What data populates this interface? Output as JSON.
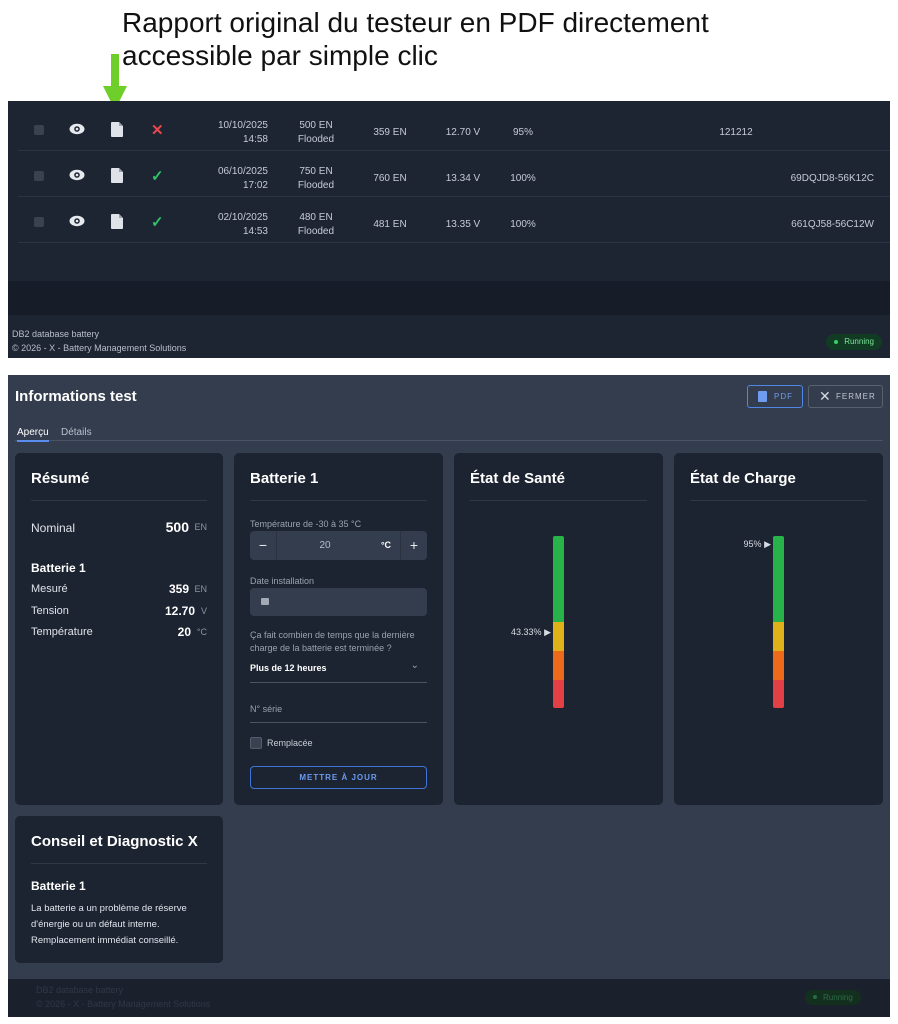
{
  "annotation": {
    "text": "Rapport original du testeur en PDF directement accessible par simple clic"
  },
  "top_table": {
    "rows": [
      {
        "date": "10/10/2025",
        "time": "14:58",
        "nominal": "500 EN",
        "type": "Flooded",
        "measured": "359 EN",
        "voltage": "12.70 V",
        "soh": "95%",
        "code": "121212",
        "serial": "",
        "status": "fail",
        "status_glyph": "✕"
      },
      {
        "date": "06/10/2025",
        "time": "17:02",
        "nominal": "750 EN",
        "type": "Flooded",
        "measured": "760 EN",
        "voltage": "13.34 V",
        "soh": "100%",
        "code": "",
        "serial": "69DQJD8-56K12C",
        "status": "ok",
        "status_glyph": "✓"
      },
      {
        "date": "02/10/2025",
        "time": "14:53",
        "nominal": "480 EN",
        "type": "Flooded",
        "measured": "481 EN",
        "voltage": "13.35 V",
        "soh": "100%",
        "code": "",
        "serial": "661QJ58-56C12W",
        "status": "ok",
        "status_glyph": "✓"
      }
    ]
  },
  "footer": {
    "app": "DB2 database battery",
    "copyright": "© 2026 - X - Battery Management Solutions",
    "status": "Running"
  },
  "dialog": {
    "title": "Informations test",
    "pdf_button": "PDF",
    "close_button": "FERMER",
    "tabs": [
      "Aperçu",
      "Détails"
    ]
  },
  "resume": {
    "title": "Résumé",
    "nominal_label": "Nominal",
    "nominal_value": "500",
    "nominal_unit": "EN",
    "battery_label": "Batterie 1",
    "rows": [
      {
        "label": "Mesuré",
        "value": "359",
        "unit": "EN"
      },
      {
        "label": "Tension",
        "value": "12.70",
        "unit": "V"
      },
      {
        "label": "Température",
        "value": "20",
        "unit": "°C"
      }
    ]
  },
  "battery_form": {
    "title": "Batterie 1",
    "temp_label": "Température de -30 à 35 °C",
    "temp_value": "20",
    "temp_unit": "°C",
    "minus": "−",
    "plus": "+",
    "date_label": "Date installation",
    "question": "Ça fait combien de temps que la dernière charge de la batterie est terminée ?",
    "charge_select": "Plus de 12 heures",
    "serial_label": "N° série",
    "replaced_label": "Remplacée",
    "update_button": "METTRE À JOUR"
  },
  "soh": {
    "title": "État de Santé",
    "marker": "43.33%",
    "value": 0.4333
  },
  "soc": {
    "title": "État de Charge",
    "marker": "95%",
    "value": 0.95
  },
  "conseil": {
    "title": "Conseil et Diagnostic X",
    "battery_label": "Batterie 1",
    "text": "La batterie a un problème de réserve d'énergie ou un défaut interne. Remplacement immédiat conseillé."
  },
  "colors": {
    "accent": "#5b8def",
    "ok": "#30c26a",
    "fail": "#e5484d",
    "gauge_green": "#27b34a",
    "gauge_yellow": "#e0b21a",
    "gauge_orange": "#ec6a1a",
    "gauge_red": "#e24044"
  }
}
